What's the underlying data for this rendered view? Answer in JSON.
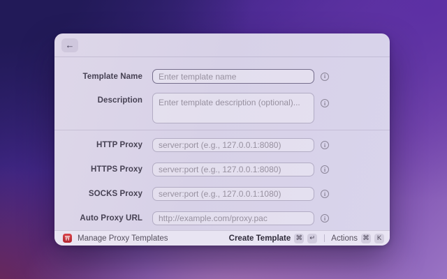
{
  "window": {
    "title_hidden": "",
    "header": {
      "back_icon_glyph": "←"
    },
    "form": {
      "rows": [
        {
          "label": "Template Name",
          "placeholder": "Enter template name"
        },
        {
          "label": "Description",
          "placeholder": "Enter template description (optional)..."
        },
        {
          "label": "HTTP Proxy",
          "placeholder": "server:port (e.g., 127.0.0.1:8080)"
        },
        {
          "label": "HTTPS Proxy",
          "placeholder": "server:port (e.g., 127.0.0.1:8080)"
        },
        {
          "label": "SOCKS Proxy",
          "placeholder": "server:port (e.g., 127.0.0.1:1080)"
        },
        {
          "label": "Auto Proxy URL",
          "placeholder": "http://example.com/proxy.pac"
        }
      ],
      "info_icon_glyph": "i"
    },
    "footer": {
      "app_name": "Manage Proxy Templates",
      "primary_action": "Create Template",
      "primary_shortcut": [
        "⌘",
        "↵"
      ],
      "secondary_action": "Actions",
      "secondary_shortcut": [
        "⌘",
        "K"
      ]
    }
  },
  "colors": {
    "app_icon": "#c9353d",
    "window_bg": "#d9d3e8",
    "background_top_left": "#221a58",
    "background_top_right": "#5c2fa4",
    "background_bottom_left": "#6b2e54",
    "background_bottom_right": "#9a74c4",
    "focused_border": "#756d8c"
  }
}
